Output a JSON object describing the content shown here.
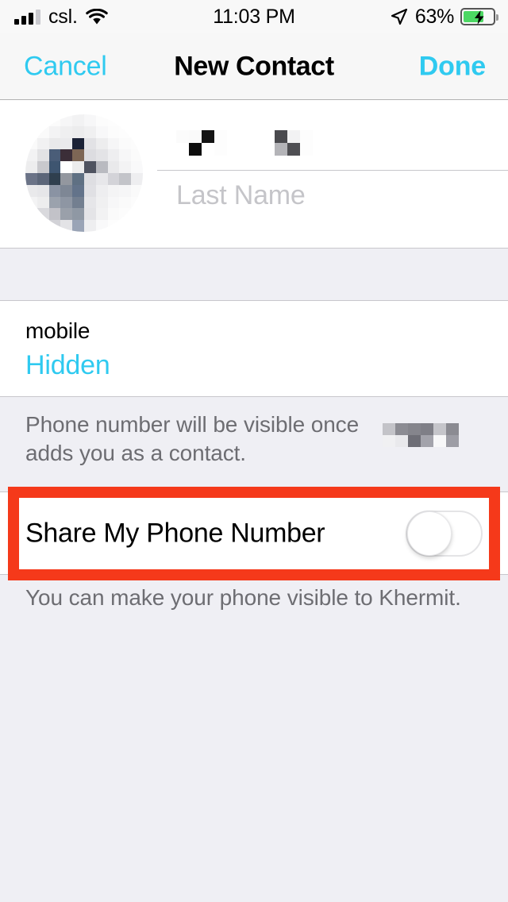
{
  "status_bar": {
    "carrier": "csl.",
    "time": "11:03 PM",
    "battery_percent": "63%",
    "battery_level": 63,
    "charging": true,
    "signal_bars_filled": 3,
    "signal_bars_total": 4,
    "wifi": true,
    "location_services": true
  },
  "nav_bar": {
    "cancel_label": "Cancel",
    "title": "New Contact",
    "done_label": "Done",
    "accent_color": "#2fcaf0"
  },
  "name_section": {
    "avatar_alt": "contact-photo-blurred",
    "first_name_value": "",
    "first_name_redacted": true,
    "last_name_placeholder": "Last Name",
    "last_name_value": ""
  },
  "phone_section": {
    "label": "mobile",
    "value": "Hidden",
    "value_color": "#2fcaf0"
  },
  "footer_note_1": {
    "line_1_prefix": "Phone number will be visible once",
    "line_1_redacted_name": true,
    "line_2": "adds you as a contact."
  },
  "share_row": {
    "label": "Share My Phone Number",
    "toggle_state": "off"
  },
  "footer_note_2": {
    "text": "You can make your phone visible to Khermit."
  },
  "annotation": {
    "color": "#f5391a",
    "target": "share-my-phone-number-row"
  },
  "colors": {
    "background": "#efeff4",
    "row_background": "#ffffff",
    "separator": "#c8c7cc",
    "secondary_text": "#6d6d72",
    "placeholder_text": "#c5c5c9",
    "battery_green": "#4cd763"
  }
}
